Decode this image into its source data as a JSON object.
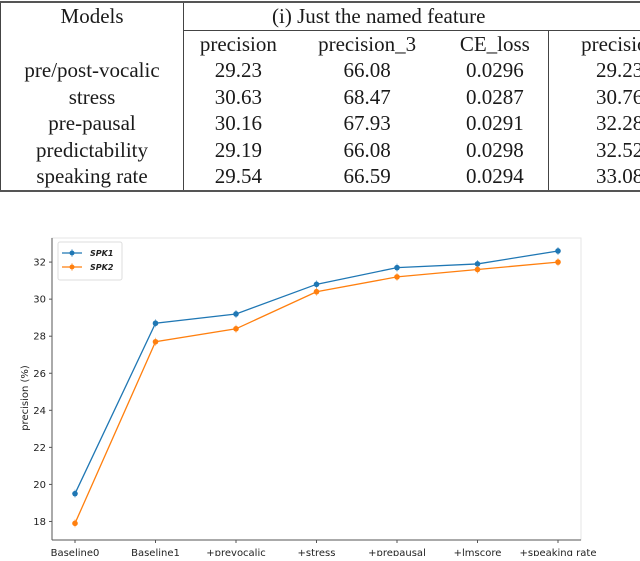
{
  "table": {
    "model_header": "Models",
    "group_header": "(i) Just the named feature",
    "columns": [
      "precision",
      "precision_3",
      "CE_loss",
      "precision"
    ],
    "rows": [
      {
        "model": "pre/post-vocalic",
        "precision": "29.23",
        "precision_3": "66.08",
        "ce_loss": "0.0296",
        "precision_b": "29.23"
      },
      {
        "model": "stress",
        "precision": "30.63",
        "precision_3": "68.47",
        "ce_loss": "0.0287",
        "precision_b": "30.76"
      },
      {
        "model": "pre-pausal",
        "precision": "30.16",
        "precision_3": "67.93",
        "ce_loss": "0.0291",
        "precision_b": "32.28"
      },
      {
        "model": "predictability",
        "precision": "29.19",
        "precision_3": "66.08",
        "ce_loss": "0.0298",
        "precision_b": "32.52"
      },
      {
        "model": "speaking rate",
        "precision": "29.54",
        "precision_3": "66.59",
        "ce_loss": "0.0294",
        "precision_b": "33.08"
      }
    ]
  },
  "chart_data": {
    "type": "line",
    "title": "",
    "xlabel": "",
    "ylabel": "precision (%)",
    "categories": [
      "Baseline0",
      "Baseline1",
      "+prevocalic",
      "+stress",
      "+prepausal",
      "+lmscore",
      "+speaking rate"
    ],
    "series": [
      {
        "name": "SPK1",
        "color": "#1f77b4",
        "values": [
          19.5,
          28.7,
          29.2,
          30.8,
          31.7,
          31.9,
          32.6
        ]
      },
      {
        "name": "SPK2",
        "color": "#ff7f0e",
        "values": [
          17.9,
          27.7,
          28.4,
          30.4,
          31.2,
          31.6,
          32.0
        ]
      }
    ],
    "ylim": [
      17.0,
      33.3
    ],
    "yticks": [
      18,
      20,
      22,
      24,
      26,
      28,
      30,
      32
    ],
    "ytick_labels": [
      "18",
      "20",
      "22",
      "24",
      "26",
      "28",
      "30",
      "32"
    ],
    "grid": false,
    "legend": "top-left",
    "error_bars": true
  }
}
